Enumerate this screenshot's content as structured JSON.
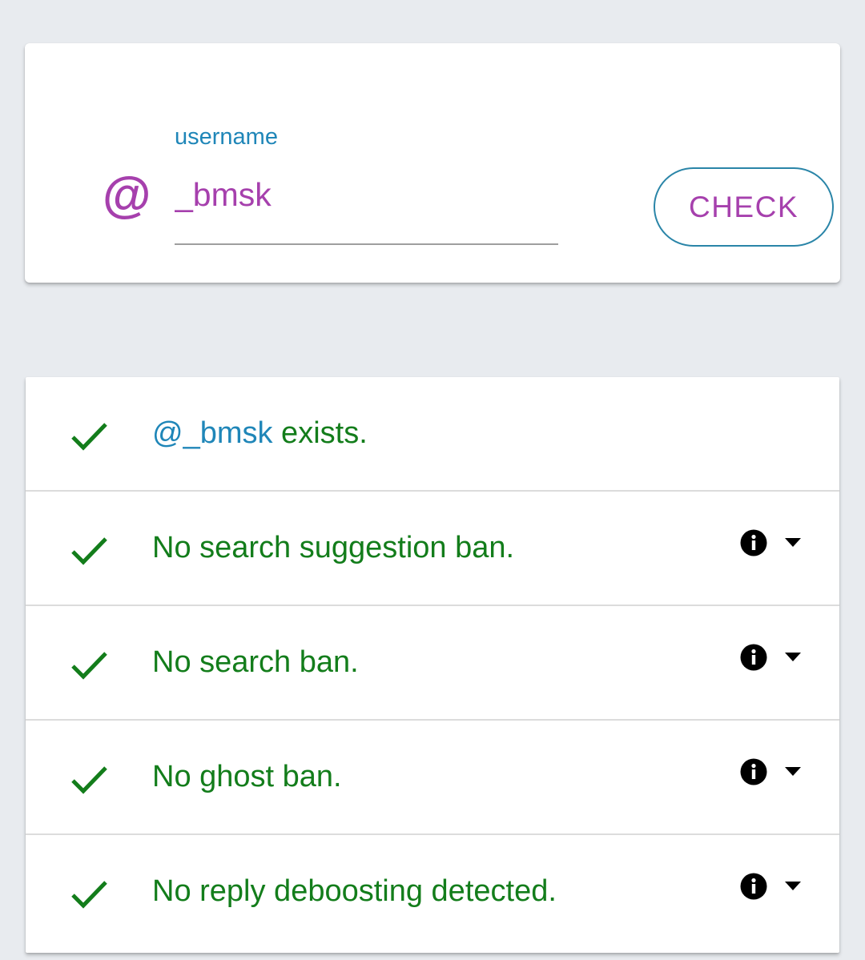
{
  "colors": {
    "accent": "#a640ad",
    "label": "#1f86b8",
    "success": "#137d1b",
    "username_link": "#1f86b8",
    "button_border": "#2a85a8",
    "icon_dark": "#000000"
  },
  "search": {
    "at_symbol": "@",
    "label": "username",
    "value": "_bmsk",
    "button_label": "CHECK"
  },
  "results": {
    "exists": {
      "username": "@_bmsk",
      "suffix": " exists."
    },
    "rows": [
      {
        "text": "No search suggestion ban.",
        "icon": "check-icon",
        "info_icon": "info-icon",
        "dropdown_icon": "caret-down-icon"
      },
      {
        "text": "No search ban.",
        "icon": "check-icon",
        "info_icon": "info-icon",
        "dropdown_icon": "caret-down-icon"
      },
      {
        "text": "No ghost ban.",
        "icon": "check-icon",
        "info_icon": "info-icon",
        "dropdown_icon": "caret-down-icon"
      },
      {
        "text": "No reply deboosting detected.",
        "icon": "check-icon",
        "info_icon": "info-icon",
        "dropdown_icon": "caret-down-icon"
      }
    ]
  }
}
